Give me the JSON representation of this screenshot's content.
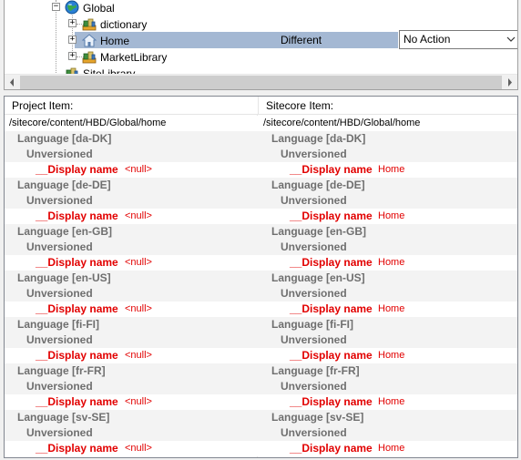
{
  "tree": {
    "nodes": [
      {
        "label": "Global",
        "icon": "globe-icon"
      },
      {
        "label": "dictionary",
        "icon": "library-books-icon"
      },
      {
        "label": "Home",
        "icon": "home-icon"
      },
      {
        "label": "MarketLibrary",
        "icon": "library-books-icon"
      },
      {
        "label": "SiteLibrary",
        "icon": "library-books-icon"
      }
    ],
    "selected_status": "Different",
    "action_value": "No Action"
  },
  "grid": {
    "left_header": "Project Item:",
    "right_header": "Sitecore Item:",
    "left_path": "/sitecore/content/HBD/Global/home",
    "right_path": "/sitecore/content/HBD/Global/home",
    "unversioned_label": "Unversioned",
    "field_name": "__Display name",
    "left_value": "<null>",
    "right_value": "Home",
    "languages": [
      "Language [da-DK]",
      "Language [de-DE]",
      "Language [en-GB]",
      "Language [en-US]",
      "Language [fi-FI]",
      "Language [fr-FR]",
      "Language [sv-SE]"
    ]
  },
  "colors": {
    "selection": "#a4b8d3",
    "field_red": "#e20000",
    "muted_text": "#6f6f6f"
  }
}
